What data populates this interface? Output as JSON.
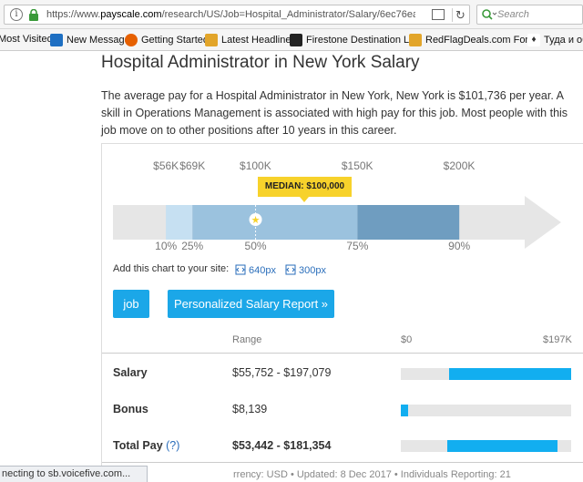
{
  "browser": {
    "url_prefix": "https://www.",
    "url_host": "payscale.com",
    "url_rest": "/research/US/Job=Hospital_Administrator/Salary/6ec76ea9/New-",
    "search_placeholder": "Search",
    "status_text": "necting to sb.voicefive.com..."
  },
  "bookmarks": [
    {
      "label": "Most Visited",
      "icon": "gear-icon",
      "color": "#6a6a6a"
    },
    {
      "label": "New Message",
      "icon": "outlook-icon",
      "color": "#1e6fc2"
    },
    {
      "label": "Getting Started",
      "icon": "firefox-icon",
      "color": "#e66000"
    },
    {
      "label": "Latest Headlines",
      "icon": "rss-icon",
      "color": "#e2a52a"
    },
    {
      "label": "Firestone Destination L...",
      "icon": "page-icon",
      "color": "#222222"
    },
    {
      "label": "RedFlagDeals.com For...",
      "icon": "rss-icon",
      "color": "#e2a52a"
    },
    {
      "label": "Туда и обр",
      "icon": "bird-icon",
      "color": "#333333"
    }
  ],
  "page": {
    "title": "Hospital Administrator in New York Salary",
    "intro": "The average pay for a Hospital Administrator in New York, New York is $101,736 per year. A skill in Operations Management is associated with high pay for this job. Most people with this job move on to other positions after 10 years in this career."
  },
  "chart_data": {
    "type": "range",
    "median_label": "MEDIAN: $100,000",
    "median_value": 100000,
    "axis_min": 30000,
    "axis_max": 250000,
    "dollar_ticks": [
      {
        "label": "$56K",
        "value": 56000
      },
      {
        "label": "$69K",
        "value": 69000
      },
      {
        "label": "$100K",
        "value": 100000
      },
      {
        "label": "$150K",
        "value": 150000
      },
      {
        "label": "$200K",
        "value": 200000
      }
    ],
    "percentile_ticks": [
      {
        "label": "10%",
        "value": 56000
      },
      {
        "label": "25%",
        "value": 69000
      },
      {
        "label": "50%",
        "value": 100000
      },
      {
        "label": "75%",
        "value": 150000
      },
      {
        "label": "90%",
        "value": 200000
      }
    ],
    "colors": {
      "track": "#e6e6e6",
      "p10_p25": "#c6e0f2",
      "p25_p75": "#9bc2de",
      "p75_p90": "#6f9dc0",
      "median_marker": "#f7d22b"
    }
  },
  "embed": {
    "label": "Add this chart to your site:",
    "link_640": "640px",
    "link_300": "300px"
  },
  "buttons": {
    "job": "job",
    "report": "Personalized Salary Report »"
  },
  "table": {
    "col_range": "Range",
    "scale_min": "$0",
    "scale_max": "$197K",
    "scale_max_value": 197000,
    "rows": [
      {
        "label": "Salary",
        "value": "$55,752 - $197,079",
        "low": 55752,
        "high": 197079
      },
      {
        "label": "Bonus",
        "value": "$8,139",
        "low": 0,
        "high": 8139
      },
      {
        "label": "Total Pay",
        "help": "(?)",
        "value": "$53,442 - $181,354",
        "low": 53442,
        "high": 181354
      }
    ],
    "footer": "rrency: USD • Updated: 8 Dec 2017 • Individuals Reporting: 21"
  }
}
